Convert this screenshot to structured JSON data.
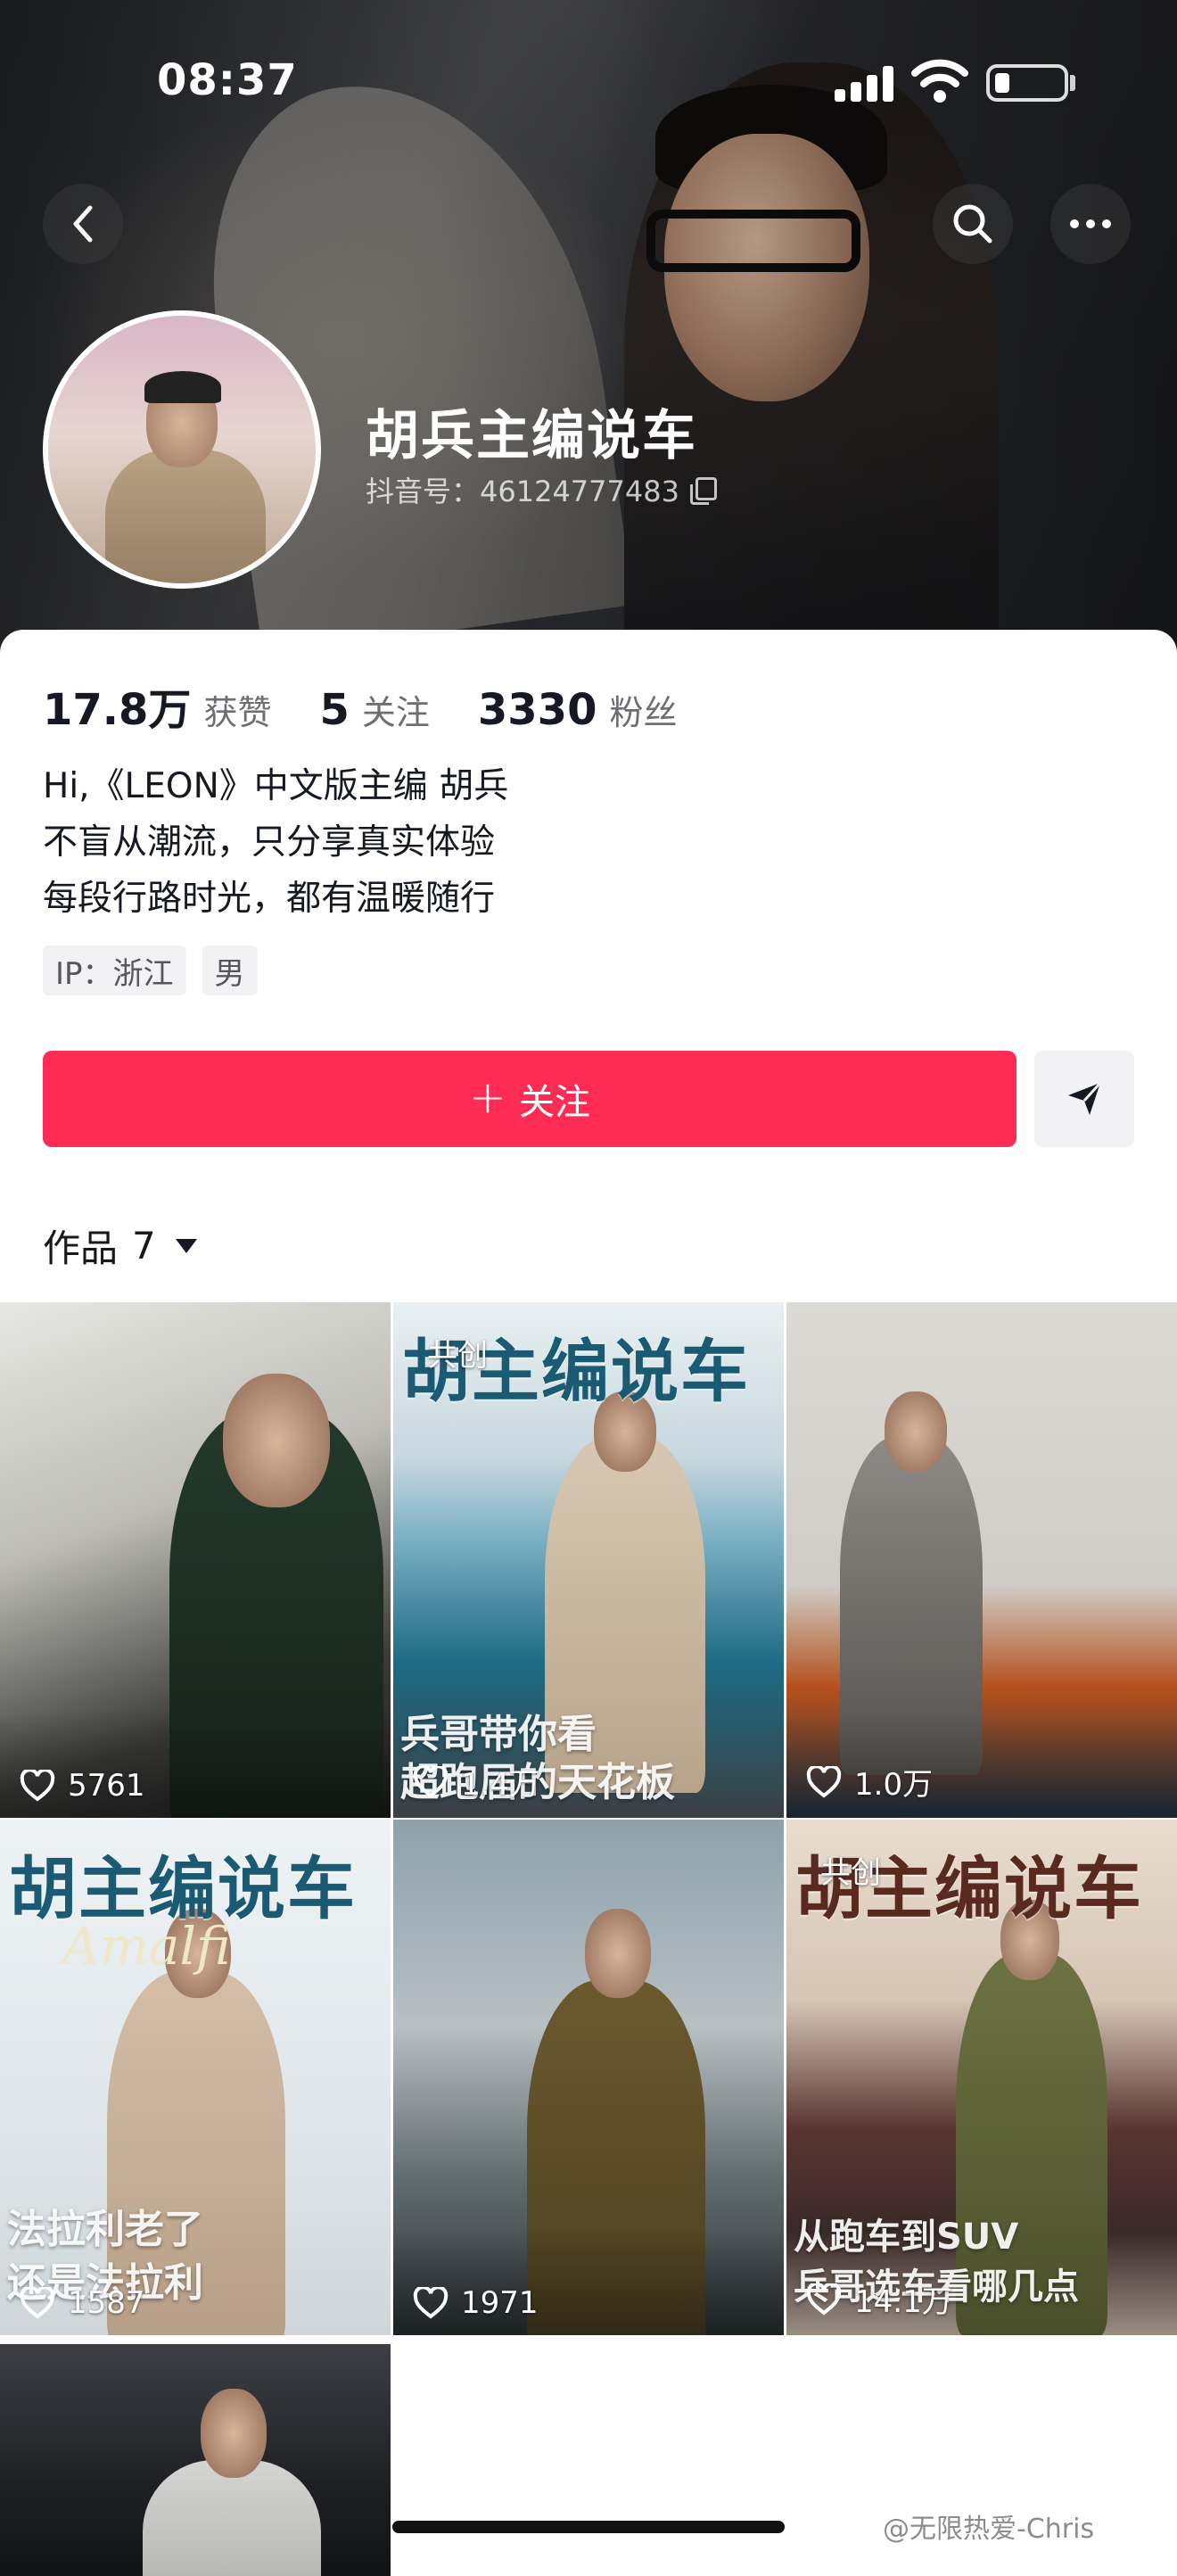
{
  "status_bar": {
    "time": "08:37"
  },
  "profile": {
    "name": "胡兵主编说车",
    "douyin_id": "抖音号：46124777483"
  },
  "stats": [
    {
      "value": "17.8万",
      "label": "获赞"
    },
    {
      "value": "5",
      "label": "关注"
    },
    {
      "value": "3330",
      "label": "粉丝"
    }
  ],
  "bio": [
    "Hi,《LEON》中文版主编 胡兵",
    "不盲从潮流，只分享真实体验",
    "每段行路时光，都有温暖随行"
  ],
  "tags": [
    "IP：浙江",
    "男"
  ],
  "actions": {
    "follow_label": "关注",
    "plus": "+"
  },
  "works": {
    "label": "作品",
    "count": "7"
  },
  "tiles": [
    {
      "likes": "5761",
      "headline": "",
      "cotag": "",
      "overlay": ""
    },
    {
      "likes": "1.4万",
      "headline": "胡主编说车",
      "cotag": "共创",
      "overlay": "兵哥带你看\n超跑届的天花板"
    },
    {
      "likes": "1.0万",
      "headline": "",
      "cotag": "",
      "overlay": ""
    },
    {
      "likes": "1587",
      "headline": "胡主编说车",
      "cotag": "",
      "overlay": "法拉利老了\n还是法拉利",
      "sub": "Amalfi"
    },
    {
      "likes": "1971",
      "headline": "",
      "cotag": "",
      "overlay": ""
    },
    {
      "likes": "14.1万",
      "headline": "胡主编说车",
      "cotag": "共创",
      "overlay": "从跑车到SUV\n兵哥选车看哪几点"
    },
    {
      "likes": "",
      "headline": "",
      "cotag": "",
      "overlay": ""
    }
  ],
  "watermark": "@无限热爱-Chris",
  "colors": {
    "accent": "#fe2c55",
    "headline": "#1b5a73"
  }
}
